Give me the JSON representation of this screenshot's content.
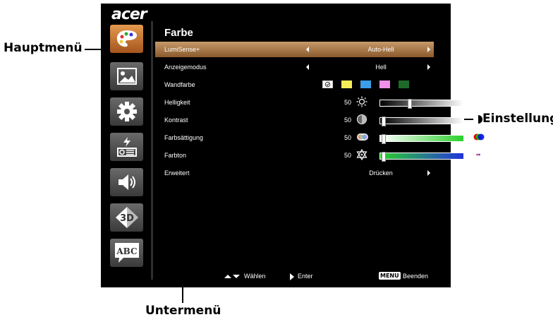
{
  "annotations": {
    "hauptmenu": "Hauptmenü",
    "einstellung": "Einstellung",
    "untermenu": "Untermenü"
  },
  "osd": {
    "logo": "acer",
    "title": "Farbe",
    "rows": [
      {
        "label": "LumiSense+",
        "value": "Auto-Hell"
      },
      {
        "label": "Anzeigemodus",
        "value": "Hell"
      },
      {
        "label": "Wandfarbe"
      },
      {
        "label": "Helligkeit",
        "value": "50"
      },
      {
        "label": "Kontrast",
        "value": "50"
      },
      {
        "label": "Farbsättigung",
        "value": "50"
      },
      {
        "label": "Farbton",
        "value": "50"
      },
      {
        "label": "Erweitert",
        "value": "Drücken"
      }
    ],
    "footer": {
      "select": "Wählen",
      "enter": "Enter",
      "menu_key": "MENU",
      "exit": "Beenden"
    },
    "wall_colors": [
      "#ffffff",
      "#f5ef5a",
      "#3a9ee8",
      "#f090e8",
      "#1e6a2a"
    ],
    "accent": "#c79a6a",
    "levels": {
      "brightness": 0.35,
      "contrast": 0.02,
      "saturation": 0.02,
      "tint": 0.02
    }
  },
  "icons": [
    "palette-icon",
    "image-icon",
    "gear-icon",
    "projector-icon",
    "speaker-icon",
    "3d-icon",
    "abc-language-icon"
  ]
}
